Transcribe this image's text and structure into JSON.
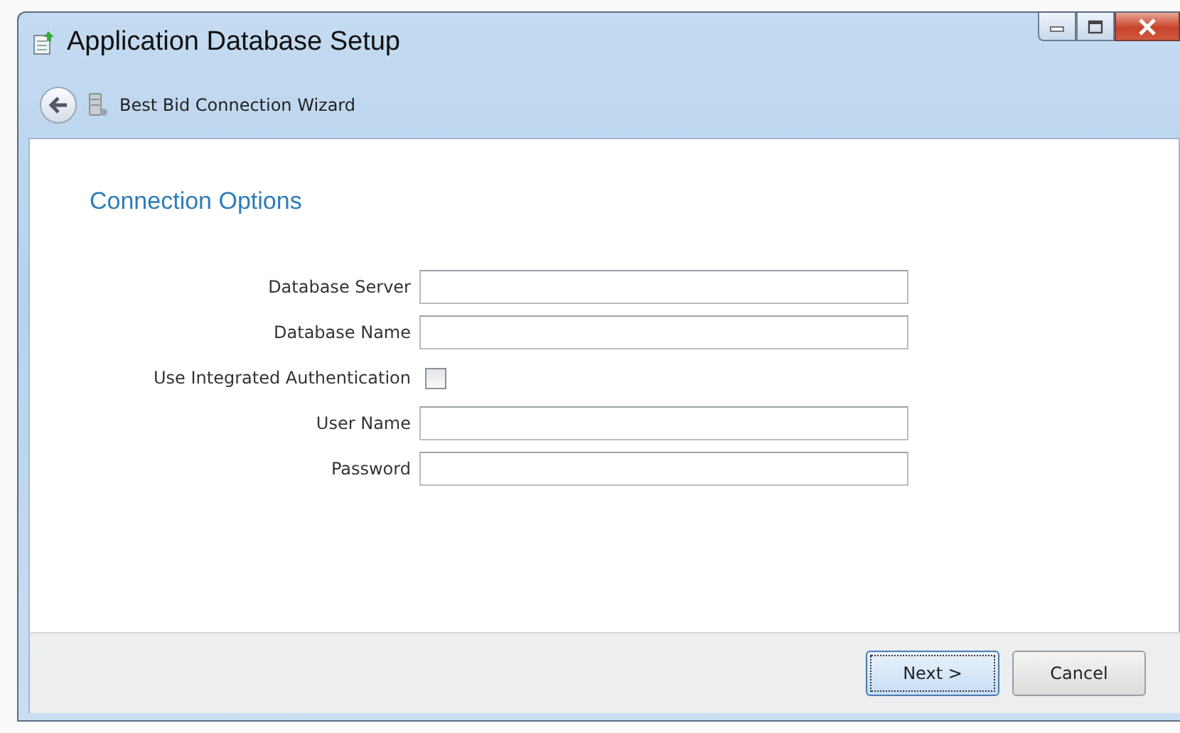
{
  "window": {
    "title": "Application Database Setup"
  },
  "navigation": {
    "title": "Best Bid Connection Wizard"
  },
  "page": {
    "heading": "Connection Options"
  },
  "fields": [
    {
      "kind": "text",
      "label": "Database Server"
    },
    {
      "kind": "text",
      "label": "Database Name"
    },
    {
      "kind": "checkbox",
      "label": "Use Integrated Authentication",
      "checked": false
    },
    {
      "kind": "text",
      "label": "User Name"
    },
    {
      "kind": "password",
      "label": "Password"
    }
  ],
  "buttons": [
    {
      "label": "Next >",
      "default": true
    },
    {
      "label": "Cancel",
      "default": false
    }
  ]
}
